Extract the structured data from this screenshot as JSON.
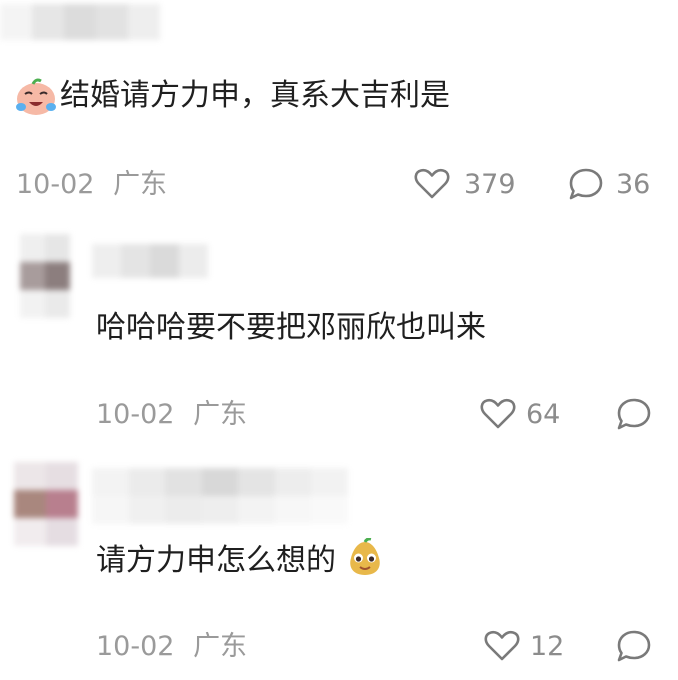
{
  "comments": [
    {
      "id": "top",
      "emoji_left": "crying-laughing-face",
      "text": "结婚请方力申，真系大吉利是",
      "date": "10-02",
      "location": "广东",
      "likes": "379",
      "replies": "36"
    },
    {
      "id": "reply1",
      "text": "哈哈哈要不要把邓丽欣也叫来",
      "date": "10-02",
      "location": "广东",
      "likes": "64"
    },
    {
      "id": "reply2",
      "text": "请方力申怎么想的",
      "emoji_right": "peeking-pear-face",
      "date": "10-02",
      "location": "广东",
      "likes": "12"
    }
  ],
  "icons": {
    "like": "heart-outline-icon",
    "reply": "speech-bubble-icon"
  },
  "colors": {
    "text": "#1f1f1f",
    "meta": "#9a9a9a",
    "icon": "#7a7a7a",
    "background": "#ffffff"
  }
}
